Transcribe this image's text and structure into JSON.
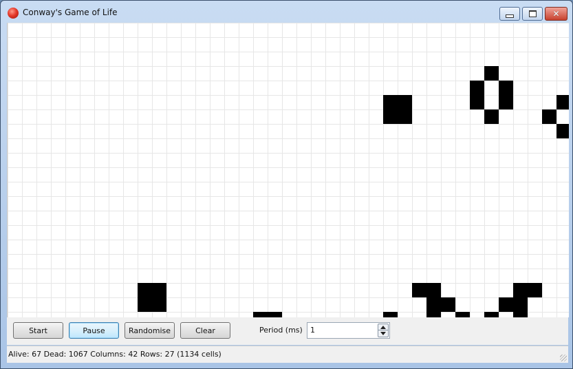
{
  "window": {
    "title": "Conway's Game of Life",
    "icon": "app-red-ball-icon"
  },
  "titlebar_buttons": {
    "minimize": "minimize-icon",
    "maximize": "maximize-icon",
    "close_glyph": "✕"
  },
  "board": {
    "columns": 42,
    "visible_rows": 21,
    "live_cells_visible": [
      [
        3,
        33
      ],
      [
        4,
        32
      ],
      [
        4,
        34
      ],
      [
        5,
        26
      ],
      [
        5,
        27
      ],
      [
        5,
        32
      ],
      [
        5,
        34
      ],
      [
        5,
        38
      ],
      [
        6,
        26
      ],
      [
        6,
        27
      ],
      [
        6,
        33
      ],
      [
        6,
        37
      ],
      [
        7,
        38
      ],
      [
        18,
        9
      ],
      [
        18,
        10
      ],
      [
        18,
        28
      ],
      [
        18,
        29
      ],
      [
        18,
        35
      ],
      [
        18,
        36
      ],
      [
        19,
        9
      ],
      [
        19,
        10
      ],
      [
        19,
        29
      ],
      [
        19,
        30
      ],
      [
        19,
        34
      ],
      [
        19,
        35
      ],
      [
        20,
        17
      ],
      [
        20,
        18
      ],
      [
        20,
        26
      ],
      [
        20,
        29
      ],
      [
        20,
        31
      ],
      [
        20,
        33
      ],
      [
        20,
        35
      ]
    ]
  },
  "controls": {
    "start_label": "Start",
    "pause_label": "Pause",
    "randomise_label": "Randomise",
    "clear_label": "Clear",
    "period_label": "Period (ms)",
    "period_value": "1"
  },
  "status": {
    "text": "Alive: 67 Dead: 1067 Columns: 42 Rows: 27 (1134 cells)"
  }
}
